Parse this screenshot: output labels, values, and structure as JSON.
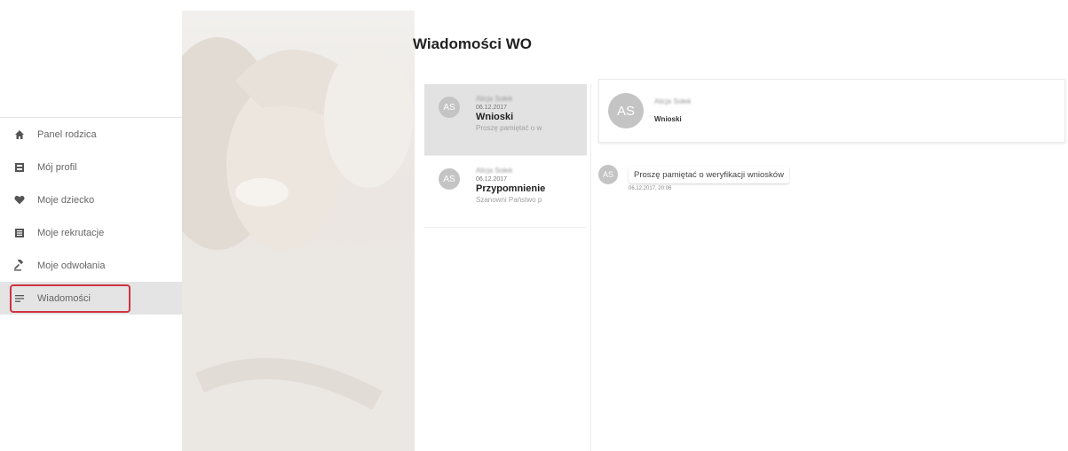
{
  "sidebar": {
    "items": [
      {
        "label": "Panel rodzica",
        "icon": "home-icon"
      },
      {
        "label": "Mój profil",
        "icon": "profile-card-icon"
      },
      {
        "label": "Moje dziecko",
        "icon": "heart-icon"
      },
      {
        "label": "Moje rekrutacje",
        "icon": "list-icon"
      },
      {
        "label": "Moje odwołania",
        "icon": "gavel-icon"
      },
      {
        "label": "Wiadomości",
        "icon": "messages-icon",
        "active": true
      }
    ],
    "highlight_color": "#d03340"
  },
  "page": {
    "title": "Wiadomości WO"
  },
  "threads": [
    {
      "initials": "AS",
      "sender": "Alicja Sołek",
      "date": "06.12.2017",
      "subject": "Wnioski",
      "preview": "Proszę pamiętać o w",
      "selected": true
    },
    {
      "initials": "AS",
      "sender": "Alicja Sołek",
      "date": "06.12.2017",
      "subject": "Przypomnienie",
      "preview": "Szanowni Państwo p"
    }
  ],
  "conversation": {
    "initials": "AS",
    "sender": "Alicja Sołek",
    "subject": "Wnioski",
    "messages": [
      {
        "initials": "AS",
        "text": "Proszę pamiętać o weryfikacji wniosków",
        "time": "06.12.2017, 20:06"
      }
    ]
  },
  "colors": {
    "avatar": "#c4c4c4",
    "selected_thread": "#e2e2e2",
    "active_nav": "#e4e4e4"
  }
}
